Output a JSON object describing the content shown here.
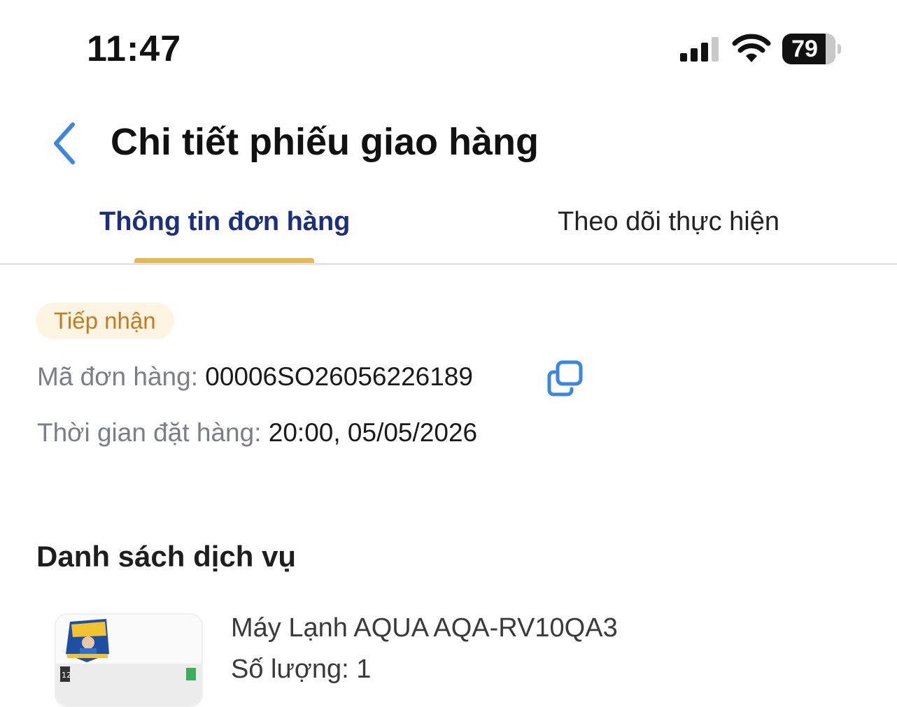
{
  "status_bar": {
    "time": "11:47",
    "battery": "79",
    "battery_level": 0.79,
    "icons": [
      "signal-icon",
      "wifi-icon",
      "battery-icon"
    ]
  },
  "header": {
    "title": "Chi tiết phiếu giao hàng",
    "back_icon": "chevron-left-icon"
  },
  "tabs": [
    {
      "label": "Thông tin đơn hàng",
      "active": true
    },
    {
      "label": "Theo dõi thực hiện",
      "active": false
    }
  ],
  "order": {
    "status": "Tiếp nhận",
    "code_label": "Mã đơn hàng:",
    "code_value": "00006SO26056226189",
    "time_label": "Thời gian đặt hàng:",
    "time_value": "20:00, 05/05/2026"
  },
  "services": {
    "title": "Danh sách dịch vụ",
    "items": [
      {
        "name": "Máy Lạnh AQUA AQA-RV10QA3",
        "quantity": "Số lượng: 1",
        "thumb_badge": "12"
      }
    ]
  },
  "colors": {
    "accent_blue": "#1b2f7c",
    "icon_blue": "#3b86e0",
    "tab_indicator": "#e6b84f",
    "badge_bg": "#fdf5e2",
    "badge_text": "#c47a23",
    "label_gray": "#7a7f85"
  }
}
